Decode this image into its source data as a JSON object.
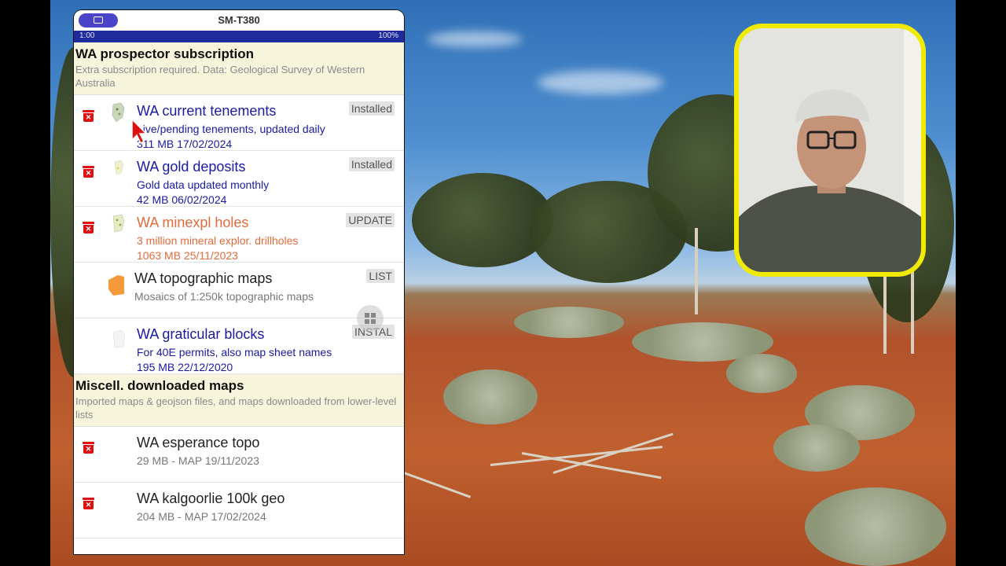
{
  "device_title": "SM-T380",
  "status": {
    "time": "1:00",
    "battery": "100%"
  },
  "sections": [
    {
      "title": "WA prospector subscription",
      "subtitle": "Extra subscription required. Data: Geological Survey of Western Australia",
      "items": [
        {
          "title": "WA current tenements",
          "desc": "Live/pending tenements, updated daily",
          "meta": "311 MB  17/02/2024",
          "badge": "Installed",
          "color": "blue"
        },
        {
          "title": "WA gold deposits",
          "desc": "Gold data updated monthly",
          "meta": "42 MB  06/02/2024",
          "badge": "Installed",
          "color": "blue"
        },
        {
          "title": "WA minexpl holes",
          "desc": "3 million mineral explor. drillholes",
          "meta": "1063 MB  25/11/2023",
          "badge": "UPDATE",
          "color": "orange"
        },
        {
          "title": "WA topographic maps",
          "desc": "Mosaics of 1:250k topographic maps",
          "meta": "",
          "badge": "LIST",
          "color": "gray"
        },
        {
          "title": "WA graticular blocks",
          "desc": "For 40E permits, also map sheet names",
          "meta": "195 MB  22/12/2020",
          "badge": "INSTAL",
          "color": "blue"
        }
      ]
    },
    {
      "title": "Miscell. downloaded maps",
      "subtitle": "Imported maps & geojson files, and maps downloaded from lower-level lists",
      "items": [
        {
          "title": "WA esperance topo",
          "meta": "29 MB - MAP 19/11/2023",
          "color": "gray"
        },
        {
          "title": "WA kalgoorlie 100k geo",
          "meta": "204 MB - MAP 17/02/2024",
          "color": "gray"
        }
      ]
    }
  ],
  "colors": {
    "status_bar": "#1f2a9c",
    "section_bg": "#f7f4dc",
    "blue_text": "#1a1aa8",
    "orange_text": "#e46a3a",
    "trash": "#e01010",
    "webcam_border": "#f0ea00"
  }
}
